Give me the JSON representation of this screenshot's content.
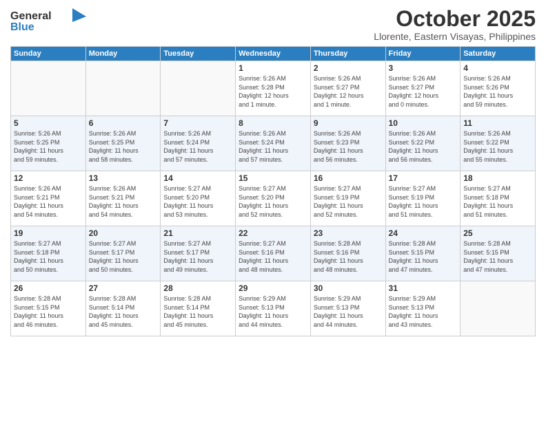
{
  "header": {
    "logo_line1": "General",
    "logo_line2": "Blue",
    "month": "October 2025",
    "location": "Llorente, Eastern Visayas, Philippines"
  },
  "weekdays": [
    "Sunday",
    "Monday",
    "Tuesday",
    "Wednesday",
    "Thursday",
    "Friday",
    "Saturday"
  ],
  "weeks": [
    [
      {
        "day": "",
        "text": ""
      },
      {
        "day": "",
        "text": ""
      },
      {
        "day": "",
        "text": ""
      },
      {
        "day": "1",
        "text": "Sunrise: 5:26 AM\nSunset: 5:28 PM\nDaylight: 12 hours\nand 1 minute."
      },
      {
        "day": "2",
        "text": "Sunrise: 5:26 AM\nSunset: 5:27 PM\nDaylight: 12 hours\nand 1 minute."
      },
      {
        "day": "3",
        "text": "Sunrise: 5:26 AM\nSunset: 5:27 PM\nDaylight: 12 hours\nand 0 minutes."
      },
      {
        "day": "4",
        "text": "Sunrise: 5:26 AM\nSunset: 5:26 PM\nDaylight: 11 hours\nand 59 minutes."
      }
    ],
    [
      {
        "day": "5",
        "text": "Sunrise: 5:26 AM\nSunset: 5:25 PM\nDaylight: 11 hours\nand 59 minutes."
      },
      {
        "day": "6",
        "text": "Sunrise: 5:26 AM\nSunset: 5:25 PM\nDaylight: 11 hours\nand 58 minutes."
      },
      {
        "day": "7",
        "text": "Sunrise: 5:26 AM\nSunset: 5:24 PM\nDaylight: 11 hours\nand 57 minutes."
      },
      {
        "day": "8",
        "text": "Sunrise: 5:26 AM\nSunset: 5:24 PM\nDaylight: 11 hours\nand 57 minutes."
      },
      {
        "day": "9",
        "text": "Sunrise: 5:26 AM\nSunset: 5:23 PM\nDaylight: 11 hours\nand 56 minutes."
      },
      {
        "day": "10",
        "text": "Sunrise: 5:26 AM\nSunset: 5:22 PM\nDaylight: 11 hours\nand 56 minutes."
      },
      {
        "day": "11",
        "text": "Sunrise: 5:26 AM\nSunset: 5:22 PM\nDaylight: 11 hours\nand 55 minutes."
      }
    ],
    [
      {
        "day": "12",
        "text": "Sunrise: 5:26 AM\nSunset: 5:21 PM\nDaylight: 11 hours\nand 54 minutes."
      },
      {
        "day": "13",
        "text": "Sunrise: 5:26 AM\nSunset: 5:21 PM\nDaylight: 11 hours\nand 54 minutes."
      },
      {
        "day": "14",
        "text": "Sunrise: 5:27 AM\nSunset: 5:20 PM\nDaylight: 11 hours\nand 53 minutes."
      },
      {
        "day": "15",
        "text": "Sunrise: 5:27 AM\nSunset: 5:20 PM\nDaylight: 11 hours\nand 52 minutes."
      },
      {
        "day": "16",
        "text": "Sunrise: 5:27 AM\nSunset: 5:19 PM\nDaylight: 11 hours\nand 52 minutes."
      },
      {
        "day": "17",
        "text": "Sunrise: 5:27 AM\nSunset: 5:19 PM\nDaylight: 11 hours\nand 51 minutes."
      },
      {
        "day": "18",
        "text": "Sunrise: 5:27 AM\nSunset: 5:18 PM\nDaylight: 11 hours\nand 51 minutes."
      }
    ],
    [
      {
        "day": "19",
        "text": "Sunrise: 5:27 AM\nSunset: 5:18 PM\nDaylight: 11 hours\nand 50 minutes."
      },
      {
        "day": "20",
        "text": "Sunrise: 5:27 AM\nSunset: 5:17 PM\nDaylight: 11 hours\nand 50 minutes."
      },
      {
        "day": "21",
        "text": "Sunrise: 5:27 AM\nSunset: 5:17 PM\nDaylight: 11 hours\nand 49 minutes."
      },
      {
        "day": "22",
        "text": "Sunrise: 5:27 AM\nSunset: 5:16 PM\nDaylight: 11 hours\nand 48 minutes."
      },
      {
        "day": "23",
        "text": "Sunrise: 5:28 AM\nSunset: 5:16 PM\nDaylight: 11 hours\nand 48 minutes."
      },
      {
        "day": "24",
        "text": "Sunrise: 5:28 AM\nSunset: 5:15 PM\nDaylight: 11 hours\nand 47 minutes."
      },
      {
        "day": "25",
        "text": "Sunrise: 5:28 AM\nSunset: 5:15 PM\nDaylight: 11 hours\nand 47 minutes."
      }
    ],
    [
      {
        "day": "26",
        "text": "Sunrise: 5:28 AM\nSunset: 5:15 PM\nDaylight: 11 hours\nand 46 minutes."
      },
      {
        "day": "27",
        "text": "Sunrise: 5:28 AM\nSunset: 5:14 PM\nDaylight: 11 hours\nand 45 minutes."
      },
      {
        "day": "28",
        "text": "Sunrise: 5:28 AM\nSunset: 5:14 PM\nDaylight: 11 hours\nand 45 minutes."
      },
      {
        "day": "29",
        "text": "Sunrise: 5:29 AM\nSunset: 5:13 PM\nDaylight: 11 hours\nand 44 minutes."
      },
      {
        "day": "30",
        "text": "Sunrise: 5:29 AM\nSunset: 5:13 PM\nDaylight: 11 hours\nand 44 minutes."
      },
      {
        "day": "31",
        "text": "Sunrise: 5:29 AM\nSunset: 5:13 PM\nDaylight: 11 hours\nand 43 minutes."
      },
      {
        "day": "",
        "text": ""
      }
    ]
  ]
}
